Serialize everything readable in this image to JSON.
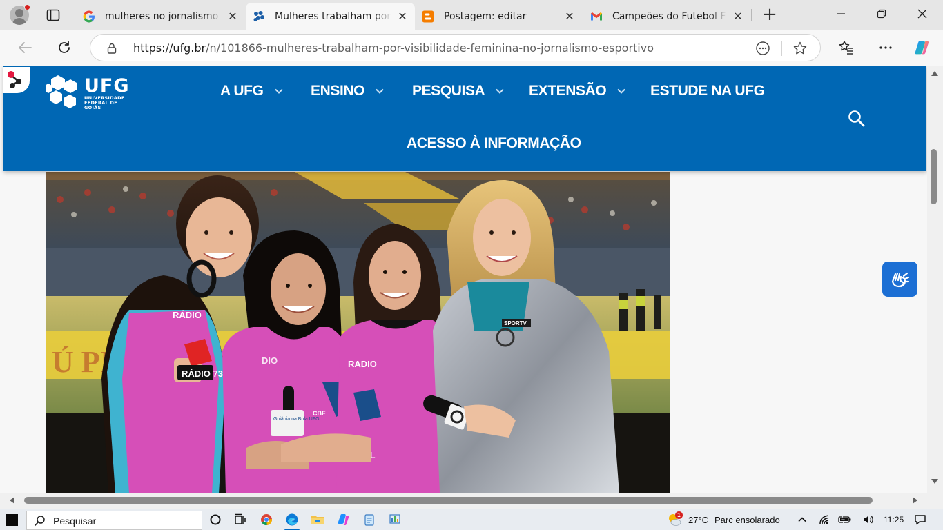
{
  "browser": {
    "tabs": [
      {
        "title": "mulheres no jornalismo",
        "favicon": "google-icon",
        "active": false
      },
      {
        "title": "Mulheres trabalham por",
        "favicon": "ufg-favicon-icon",
        "active": true
      },
      {
        "title": "Postagem: editar",
        "favicon": "blogger-icon",
        "active": false
      },
      {
        "title": "Campeões do Futebol F",
        "favicon": "gmail-icon",
        "active": false
      }
    ],
    "url_origin": "https://ufg.br",
    "url_path": "/n/101866-mulheres-trabalham-por-visibilidade-feminina-no-jornalismo-esportivo"
  },
  "site": {
    "logo_word": "UFG",
    "logo_sub": "UNIVERSIDADE FEDERAL DE GOIÁS",
    "menu": [
      {
        "label": "A UFG",
        "has_dropdown": true
      },
      {
        "label": "ENSINO",
        "has_dropdown": true
      },
      {
        "label": "PESQUISA",
        "has_dropdown": true
      },
      {
        "label": "EXTENSÃO",
        "has_dropdown": true
      },
      {
        "label": "ESTUDE NA UFG",
        "has_dropdown": false
      },
      {
        "label": "ACESSO À INFORMAÇÃO",
        "has_dropdown": false
      }
    ],
    "photo_text": {
      "bib1": "RÁDIO",
      "mic1": "RÁDIO 730",
      "bib2": "RADIO",
      "cbf": "CBF",
      "bib_bottom": "ASIL",
      "mic2": "Goiânia na Bola UFG",
      "jacket": "SPORTV"
    }
  },
  "taskbar": {
    "search_placeholder": "Pesquisar",
    "weather_badge": "1",
    "temperature": "27°C",
    "weather": "Parc ensolarado",
    "time": "11:25"
  },
  "colors": {
    "ufg_blue": "#0067b4",
    "vlibras_blue": "#1c6fd4",
    "pink_bib": "#d64fb8"
  }
}
